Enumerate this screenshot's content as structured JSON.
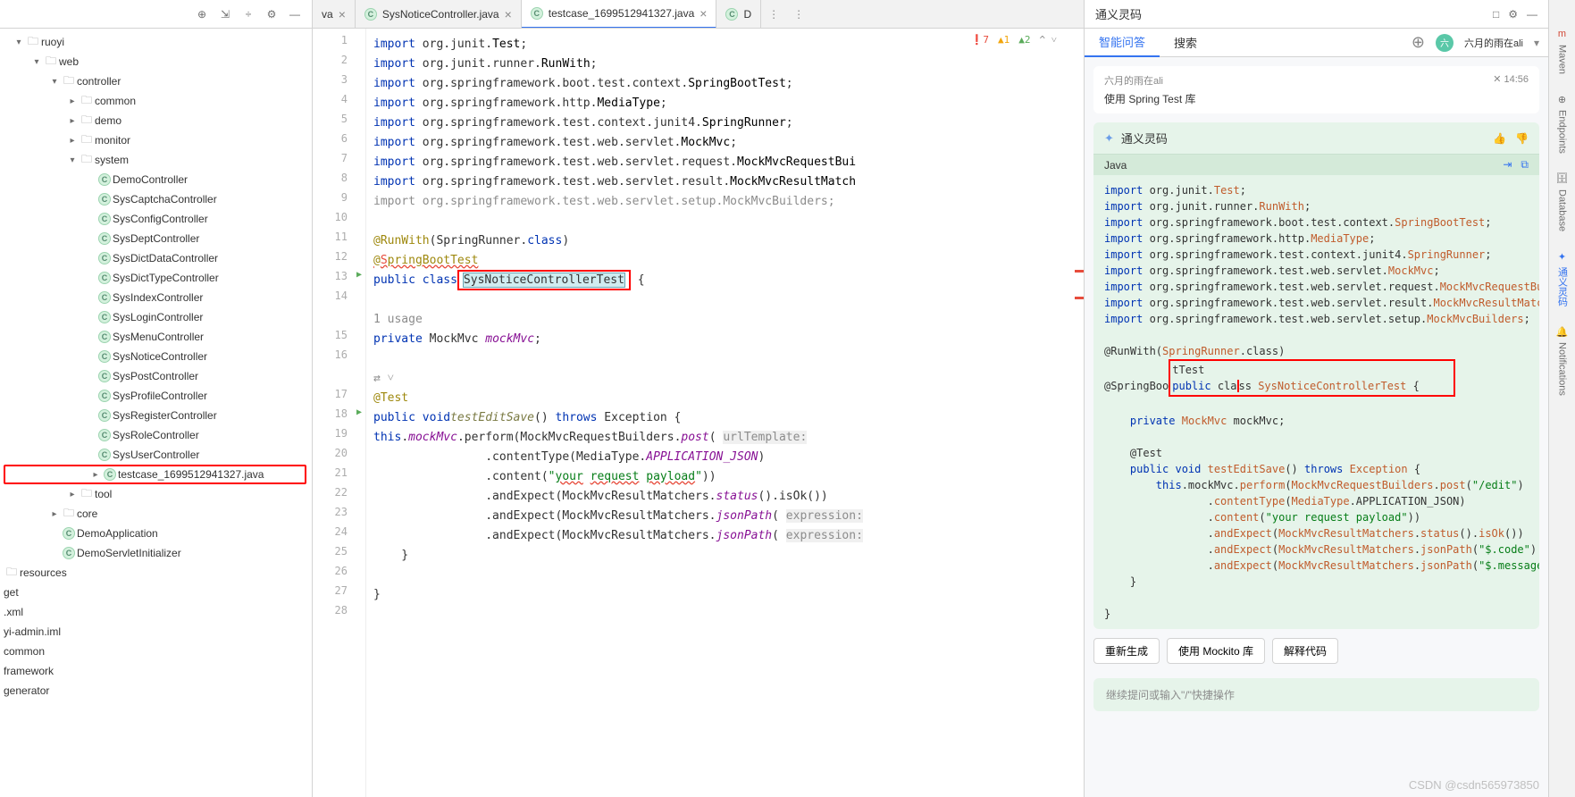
{
  "tree": {
    "root": "ruoyi",
    "web": "web",
    "controller": "controller",
    "common": "common",
    "demo": "demo",
    "monitor": "monitor",
    "system": "system",
    "system_children": [
      "DemoController",
      "SysCaptchaController",
      "SysConfigController",
      "SysDeptController",
      "SysDictDataController",
      "SysDictTypeController",
      "SysIndexController",
      "SysLoginController",
      "SysMenuController",
      "SysNoticeController",
      "SysPostController",
      "SysProfileController",
      "SysRegisterController",
      "SysRoleController",
      "SysUserController"
    ],
    "testcase": "testcase_1699512941327.java",
    "tool": "tool",
    "core": "core",
    "demoapp": "DemoApplication",
    "servletinit": "DemoServletInitializer",
    "resources": "resources",
    "get": "get",
    "xml": ".xml",
    "iml": "yi-admin.iml",
    "commonf": "common",
    "framework": "framework",
    "generator": "generator"
  },
  "tabs": {
    "t0": "va",
    "t1": "SysNoticeController.java",
    "t2": "testcase_1699512941327.java",
    "t3": "D"
  },
  "editor": {
    "indicators": {
      "err": "7",
      "warn": "1",
      "weak": "2"
    },
    "usage_hint": "1 usage",
    "lines": [
      "import org.junit.Test;",
      "import org.junit.runner.RunWith;",
      "import org.springframework.boot.test.context.SpringBootTest;",
      "import org.springframework.http.MediaType;",
      "import org.springframework.test.context.junit4.SpringRunner;",
      "import org.springframework.test.web.servlet.MockMvc;",
      "import org.springframework.test.web.servlet.request.MockMvcRequestBui",
      "import org.springframework.test.web.servlet.result.MockMvcResultMatch",
      "import org.springframework.test.web.servlet.setup.MockMvcBuilders;"
    ],
    "runwith": "@RunWith(SpringRunner.class)",
    "sbt": "@SpringBootTest",
    "classdecl_pre": "public class ",
    "classname": "SysNoticeControllerTest",
    "classdecl_post": " {",
    "mockmvc": "private MockMvc mockMvc;",
    "test_ann": "@Test",
    "testmethod": "public void testEditSave() throws Exception {",
    "perform": "this.mockMvc.perform(MockMvcRequestBuilders.post( urlTemplate:",
    "ct": ".contentType(MediaType.APPLICATION_JSON)",
    "content": ".content(\"your request payload\"))",
    "exp_status": ".andExpect(MockMvcResultMatchers.status().isOk())",
    "exp_jp1": ".andExpect(MockMvcResultMatchers.jsonPath( expression:",
    "exp_jp2": ".andExpect(MockMvcResultMatchers.jsonPath( expression:",
    "closebrace": "}"
  },
  "right": {
    "title": "通义灵码",
    "tab1": "智能问答",
    "tab2": "搜索",
    "user": "六月的雨在ali",
    "msg_user_name": "六月的雨在ali",
    "msg_text": "使用 Spring Test 库",
    "codebox_title": "通义灵码",
    "lang": "Java",
    "actions": [
      "重新生成",
      "使用 Mockito 库",
      "解释代码"
    ],
    "input_placeholder": "继续提问或输入\"/\"快捷操作"
  },
  "toolstrip": [
    "Maven",
    "Endpoints",
    "Database",
    "通义灵码",
    "Notifications"
  ],
  "watermark": "CSDN @csdn565973850"
}
